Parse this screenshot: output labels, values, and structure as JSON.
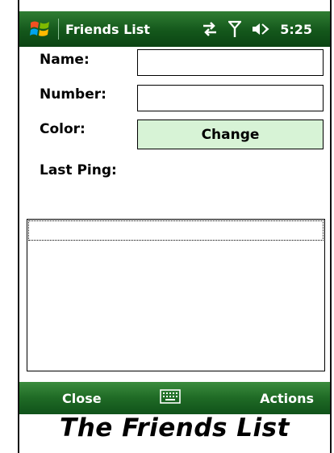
{
  "titlebar": {
    "title": "Friends List",
    "time": "5:25",
    "icons": [
      "windows-start-icon",
      "data-connection-icon",
      "signal-icon",
      "speaker-icon"
    ]
  },
  "form": {
    "name_label": "Name:",
    "name_value": "",
    "number_label": "Number:",
    "number_value": "",
    "color_label": "Color:",
    "change_label": "Change",
    "last_ping_label": "Last Ping:",
    "last_ping_value": ""
  },
  "list": {
    "items": []
  },
  "menubar": {
    "left_softkey": "Close",
    "right_softkey": "Actions",
    "center_icon": "keyboard-icon"
  },
  "caption": "The Friends List",
  "colors": {
    "bar_green": "#14571b",
    "button_fill": "#d7f3d6"
  }
}
